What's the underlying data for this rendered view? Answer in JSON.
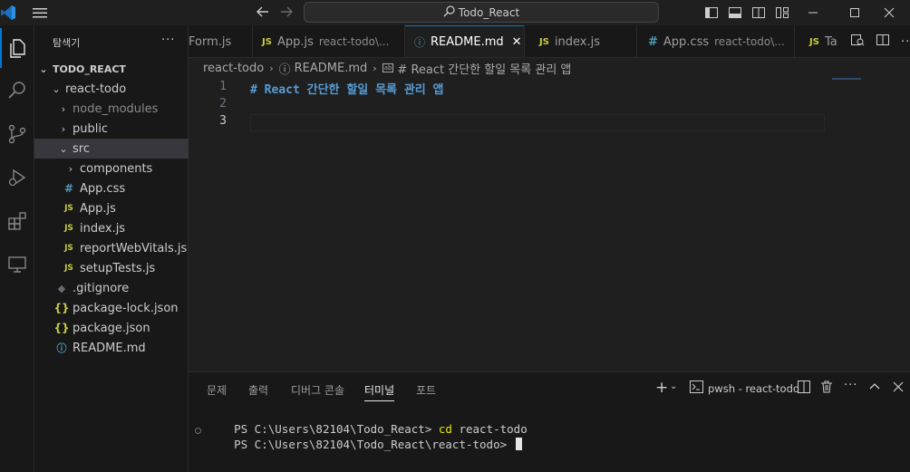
{
  "titlebar": {
    "search_text": "Todo_React"
  },
  "sidebar": {
    "title": "탐색기",
    "more": "···",
    "workspace": "TODO_REACT",
    "items": [
      {
        "label": "react-todo",
        "chev": "⌄",
        "icon": ""
      },
      {
        "label": "node_modules",
        "chev": "›",
        "icon": ""
      },
      {
        "label": "public",
        "chev": "›",
        "icon": ""
      },
      {
        "label": "src",
        "chev": "⌄",
        "icon": ""
      },
      {
        "label": "components",
        "chev": "›",
        "icon": ""
      },
      {
        "label": "App.css",
        "chev": "",
        "icon": "#"
      },
      {
        "label": "App.js",
        "chev": "",
        "icon": "JS"
      },
      {
        "label": "index.js",
        "chev": "",
        "icon": "JS"
      },
      {
        "label": "reportWebVitals.js",
        "chev": "",
        "icon": "JS"
      },
      {
        "label": "setupTests.js",
        "chev": "",
        "icon": "JS"
      },
      {
        "label": ".gitignore",
        "chev": "",
        "icon": "◆"
      },
      {
        "label": "package-lock.json",
        "chev": "",
        "icon": "{}"
      },
      {
        "label": "package.json",
        "chev": "",
        "icon": "{}"
      },
      {
        "label": "README.md",
        "chev": "",
        "icon": "ⓘ"
      }
    ]
  },
  "tabs": [
    {
      "label": "Form.js",
      "desc": "",
      "icon": ""
    },
    {
      "label": "App.js",
      "desc": "react-todo\\...",
      "icon": "JS"
    },
    {
      "label": "README.md",
      "desc": "",
      "icon": "ⓘ",
      "close": "✕"
    },
    {
      "label": "index.js",
      "desc": "",
      "icon": "JS"
    },
    {
      "label": "App.css",
      "desc": "react-todo\\...",
      "icon": "#"
    },
    {
      "label": "Ta",
      "desc": "",
      "icon": "JS"
    }
  ],
  "breadcrumb": {
    "folder": "react-todo",
    "file": "README.md",
    "symbol": "# React 간단한 할일 목록 관리 앱"
  },
  "editor": {
    "lines": [
      {
        "num": "1",
        "text": "# React 간단한 할일 목록 관리 앱"
      },
      {
        "num": "2",
        "text": ""
      },
      {
        "num": "3",
        "text": ""
      }
    ]
  },
  "panel": {
    "tabs": [
      "문제",
      "출력",
      "디버그 콘솔",
      "터미널",
      "포트"
    ],
    "active_tab": "터미널",
    "terminal_name": "pwsh - react-todo",
    "lines": [
      {
        "prompt": "PS C:\\Users\\82104\\Todo_React> ",
        "cmd": "cd",
        "rest": " react-todo"
      },
      {
        "prompt": "PS C:\\Users\\82104\\Todo_React\\react-todo> ",
        "cmd": "",
        "rest": ""
      }
    ]
  },
  "colors": {
    "accent": "#0078d4",
    "js_yellow": "#cbcb41",
    "md_blue": "#569cd6"
  }
}
